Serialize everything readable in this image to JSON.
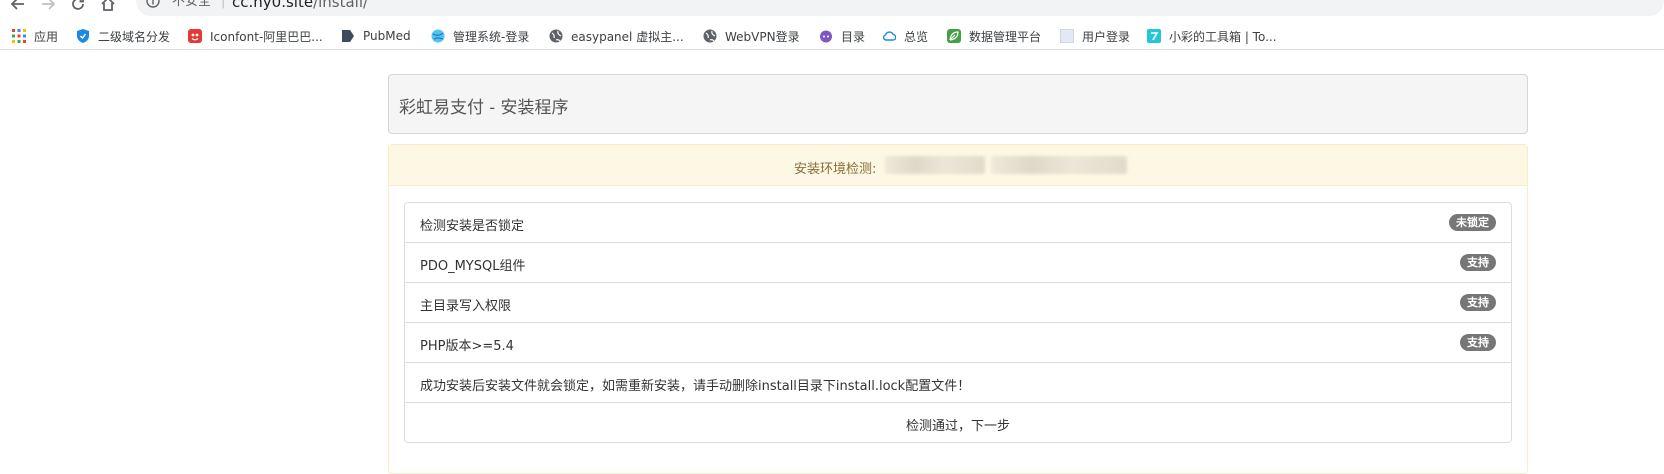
{
  "browser": {
    "url_security": "不安全",
    "url_host": "cc.ny0.site",
    "url_path": "/install/",
    "bookmarks": [
      {
        "label": "应用",
        "icon": "apps-grid-icon"
      },
      {
        "label": "二级域名分发",
        "icon": "shield-icon"
      },
      {
        "label": "Iconfont-阿里巴巴...",
        "icon": "iconfont-logo-icon"
      },
      {
        "label": "PubMed",
        "icon": "pubmed-logo-icon"
      },
      {
        "label": "管理系统-登录",
        "icon": "globe-icon"
      },
      {
        "label": "easypanel 虚拟主...",
        "icon": "world-icon"
      },
      {
        "label": "WebVPN登录",
        "icon": "world-icon"
      },
      {
        "label": "目录",
        "icon": "octocat-icon"
      },
      {
        "label": "总览",
        "icon": "cloud-icon"
      },
      {
        "label": "数据管理平台",
        "icon": "leaf-icon"
      },
      {
        "label": "用户登录",
        "icon": "blank-page-icon"
      },
      {
        "label": "小彩的工具箱 | To...",
        "icon": "toolbox-logo-icon"
      }
    ]
  },
  "page": {
    "title": "彩虹易支付 - 安装程序",
    "check_heading": "安装环境检测:",
    "checks": [
      {
        "label": "检测安装是否锁定",
        "status": "未锁定"
      },
      {
        "label": "PDO_MYSQL组件",
        "status": "支持"
      },
      {
        "label": "主目录写入权限",
        "status": "支持"
      },
      {
        "label": "PHP版本>=5.4",
        "status": "支持"
      }
    ],
    "notice": "成功安装后安装文件就会锁定，如需重新安装，请手动删除install目录下install.lock配置文件！",
    "next_button": "检测通过，下一步"
  },
  "colors": {
    "warning_bg": "#fcf8e3",
    "warning_border": "#faebcc",
    "warning_text": "#8a6d3b",
    "badge_bg": "#777777"
  }
}
